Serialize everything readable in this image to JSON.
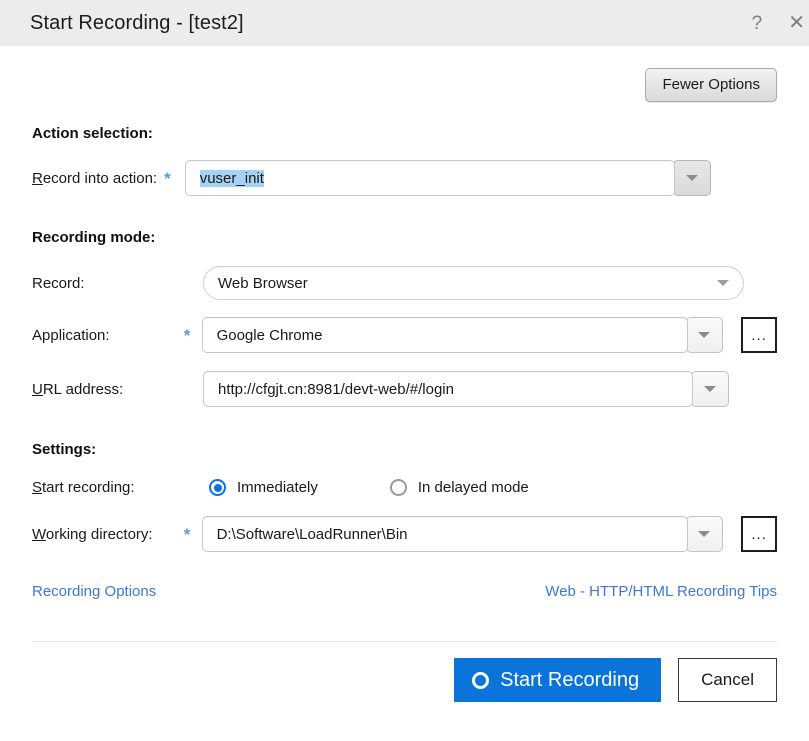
{
  "window": {
    "title": "Start Recording - [test2]",
    "help_icon": "?",
    "close_icon": "✕"
  },
  "toolbar": {
    "fewer_options_label": "Fewer Options"
  },
  "action_selection": {
    "heading": "Action selection:",
    "record_into_action": {
      "label_prefix": "R",
      "label_rest": "ecord into action:",
      "required_marker": "*",
      "value": "vuser_init"
    }
  },
  "recording_mode": {
    "heading": "Recording mode:",
    "record": {
      "label": "Record:",
      "value": "Web Browser"
    },
    "application": {
      "label": "Application:",
      "required_marker": "*",
      "value": "Google Chrome",
      "browse_label": "..."
    },
    "url_address": {
      "label_prefix": "U",
      "label_rest": "RL address:",
      "value": "http://cfgjt.cn:8981/devt-web/#/login"
    }
  },
  "settings": {
    "heading": "Settings:",
    "start_recording": {
      "label_prefix": "S",
      "label_rest": "tart recording:",
      "options": [
        {
          "label": "Immediately",
          "selected": true
        },
        {
          "label": "In delayed mode",
          "selected": false
        }
      ]
    },
    "working_directory": {
      "label_prefix": "W",
      "label_rest": "orking directory:",
      "required_marker": "*",
      "value": "D:\\Software\\LoadRunner\\Bin",
      "browse_label": "..."
    }
  },
  "links": {
    "recording_options": "Recording Options",
    "recording_tips": "Web - HTTP/HTML Recording Tips"
  },
  "footer": {
    "start_recording_label": "Start Recording",
    "cancel_label": "Cancel"
  },
  "colors": {
    "titlebar_bg": "#ececec",
    "accent_blue": "#0a74da",
    "link_blue": "#3d77dd",
    "required_star": "#5b9bd5",
    "selection_highlight": "#a6d2f4"
  }
}
